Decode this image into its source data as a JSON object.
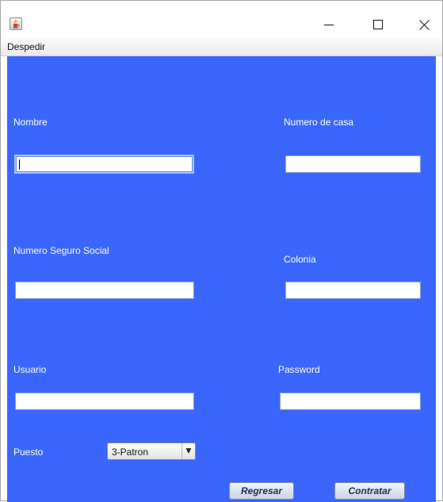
{
  "window": {
    "icon": "java-cup-icon",
    "controls": {
      "minimize": "—",
      "maximize": "☐",
      "close": "✕"
    }
  },
  "menu": {
    "items": [
      "Despedir"
    ]
  },
  "form": {
    "nombre": {
      "label": "Nombre",
      "value": ""
    },
    "numero_casa": {
      "label": "Numero de casa",
      "value": ""
    },
    "nss": {
      "label": "Numero Seguro Social",
      "value": ""
    },
    "colonia": {
      "label": "Colonia",
      "value": ""
    },
    "usuario": {
      "label": "Usuario",
      "value": ""
    },
    "password": {
      "label": "Password",
      "value": ""
    },
    "puesto": {
      "label": "Puesto",
      "selected": "3-Patron"
    }
  },
  "buttons": {
    "regresar": "Regresar",
    "contratar": "Contratar"
  },
  "colors": {
    "panel": "#3a66fe",
    "label_text": "#ffffff"
  }
}
